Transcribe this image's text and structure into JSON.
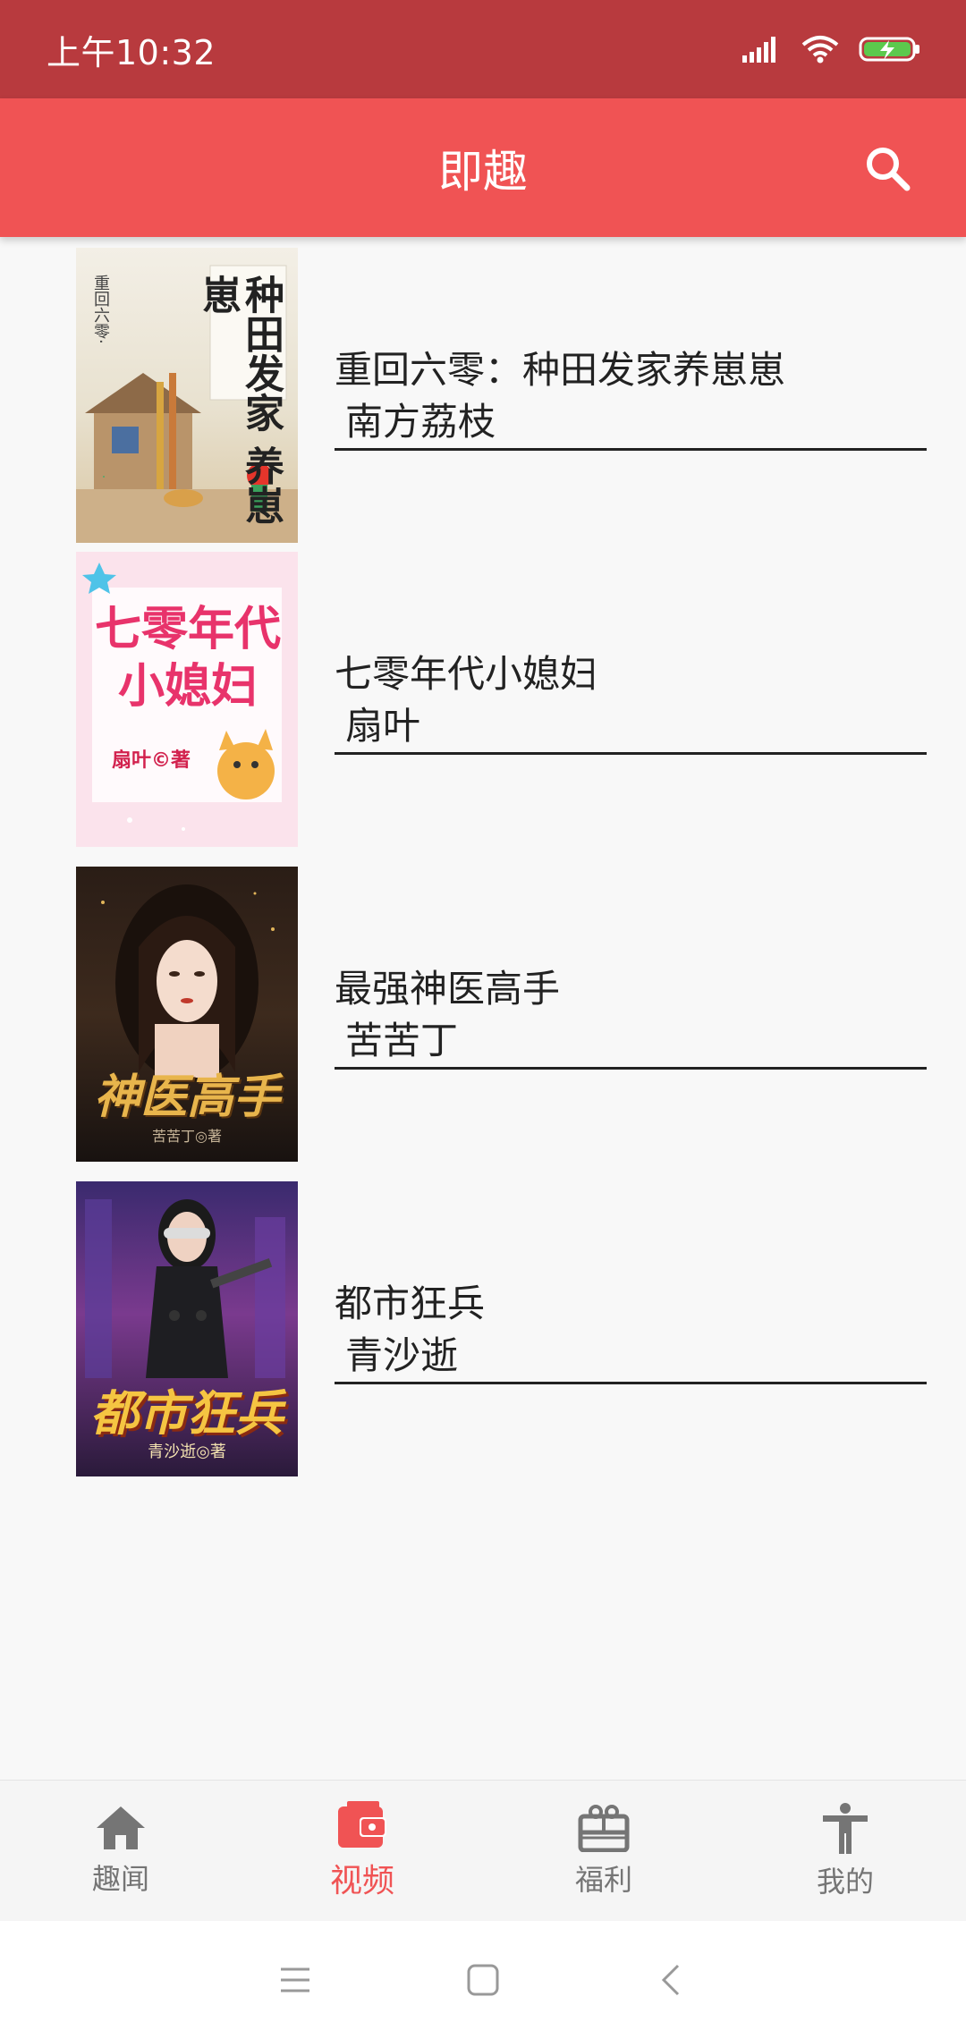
{
  "status_bar": {
    "time": "上午10:32"
  },
  "app_bar": {
    "title": "即趣"
  },
  "books": [
    {
      "title": "重回六零：种田发家养崽崽",
      "author": "南方荔枝",
      "cover_title": "种田发家 养崽崽",
      "cover_sub": "重回六零·"
    },
    {
      "title": "七零年代小媳妇",
      "author": "扇叶",
      "cover_title": "七零年代 小媳妇",
      "cover_sub": "扇叶©著"
    },
    {
      "title": "最强神医高手",
      "author": "苦苦丁",
      "cover_title": "神医高手",
      "cover_sub": "苦苦丁◎著"
    },
    {
      "title": "都市狂兵",
      "author": "青沙逝",
      "cover_title": "都市狂兵",
      "cover_sub": "青沙逝◎著"
    }
  ],
  "bottom_nav": [
    {
      "label": "趣闻",
      "icon": "home-icon"
    },
    {
      "label": "视频",
      "icon": "wallet-icon"
    },
    {
      "label": "福利",
      "icon": "gift-icon"
    },
    {
      "label": "我的",
      "icon": "person-icon"
    }
  ],
  "colors": {
    "status_bar": "#b83a3e",
    "app_bar": "#f05354",
    "active_nav": "#f05354",
    "inactive_nav": "#757575"
  }
}
